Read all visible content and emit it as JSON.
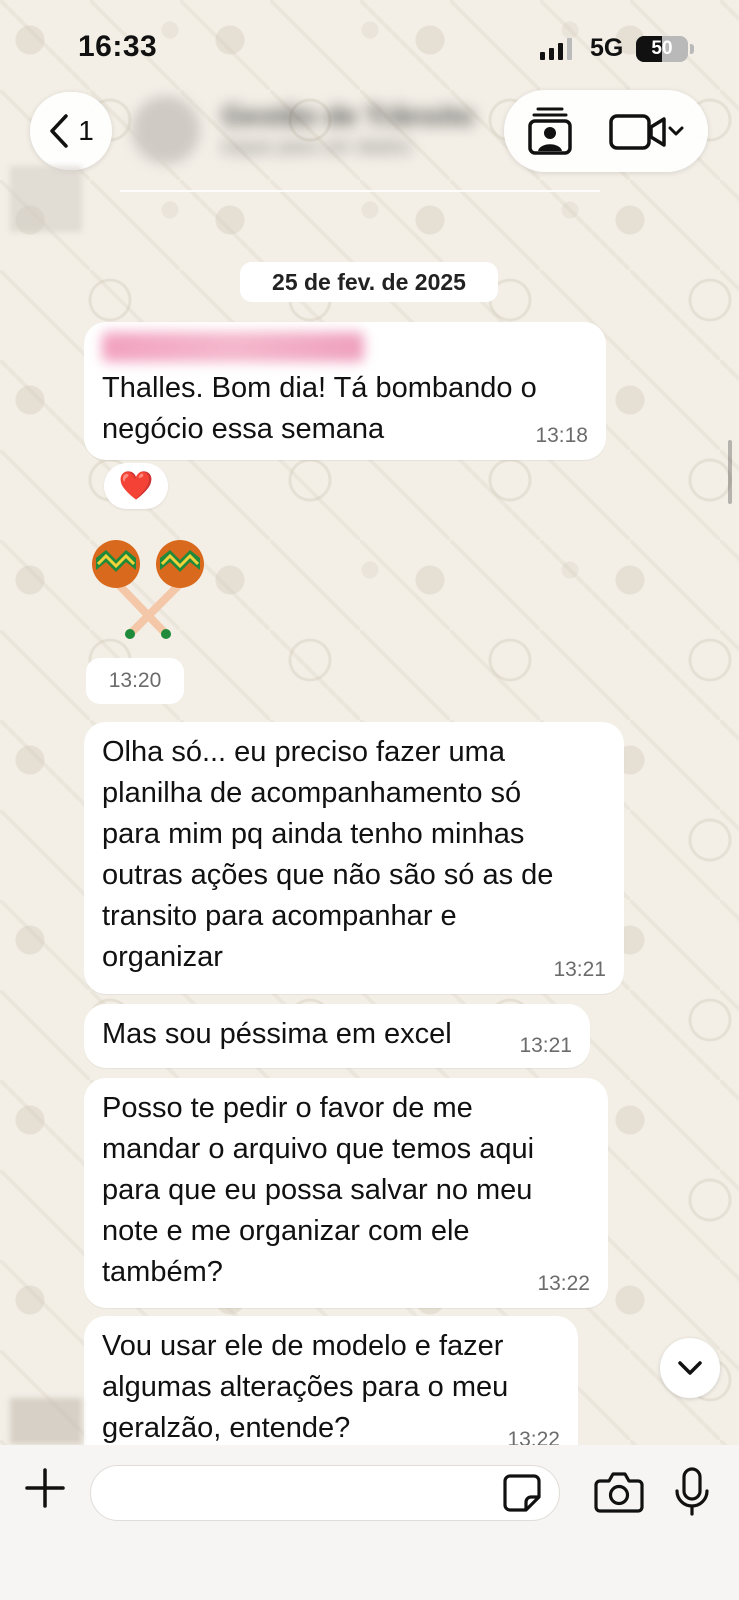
{
  "status_bar": {
    "time": "16:33",
    "network": "5G",
    "battery": "50",
    "battery_level": 0.5
  },
  "header": {
    "back_count": "1",
    "contact_name": "Gestão de Trânsito",
    "contact_subtitle": "toque para ver dados",
    "icons": [
      "chevron-left-icon",
      "contacts-card-icon",
      "video-camera-icon",
      "chevron-down-icon"
    ]
  },
  "chat": {
    "date_divider": "25 de fev. de 2025",
    "messages": [
      {
        "text": "Thalles. Bom dia! Tá bombando o\nnegócio essa semana",
        "time": "13:18",
        "reaction": "❤️"
      },
      {
        "type": "sticker",
        "sticker": "maracas",
        "time": "13:20"
      },
      {
        "text": "Olha só... eu preciso fazer uma\nplanilha de acompanhamento só\npara mim pq ainda tenho minhas\noutras ações que não são só as de\ntransito para acompanhar e\norganizar",
        "time": "13:21"
      },
      {
        "text": "Mas sou péssima em excel",
        "time": "13:21"
      },
      {
        "text": "Posso te pedir o favor de me\nmandar o arquivo que temos aqui\npara que eu possa salvar no meu\nnote e me organizar com ele\ntambém?",
        "time": "13:22"
      },
      {
        "text": "Vou usar ele de modelo e fazer\nalgumas alterações para o meu\ngeralzão, entende?",
        "time": "13:22"
      }
    ]
  },
  "composer": {
    "input_value": "",
    "icons": [
      "plus-icon",
      "sticker-icon",
      "camera-icon",
      "microphone-icon"
    ]
  },
  "colors": {
    "wallpaper": "#f3efe7",
    "bubble": "#ffffff",
    "time_text": "#6b6b6b",
    "reaction_heart": "#e0182d"
  }
}
